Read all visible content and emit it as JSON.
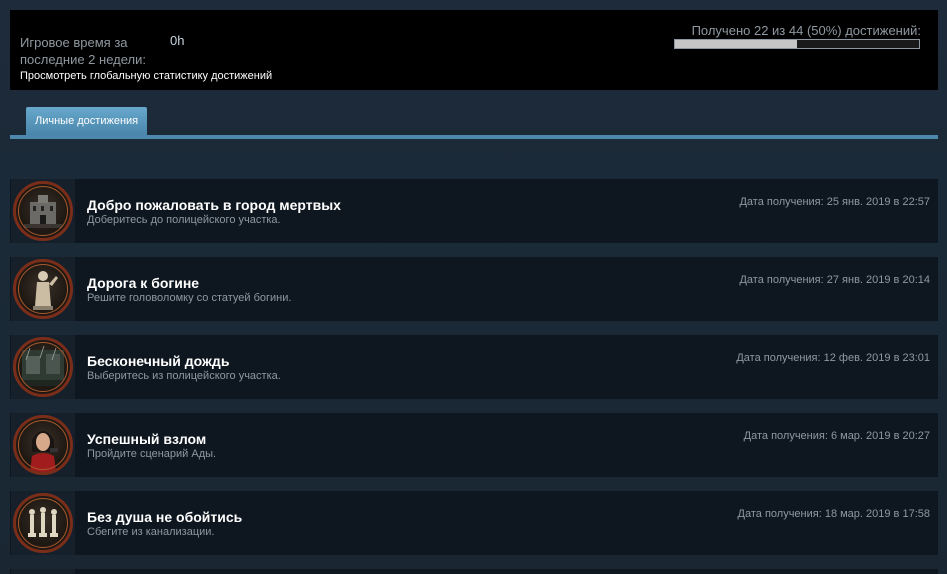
{
  "stats": {
    "playtime_label": "Игровое время за последние 2 недели:",
    "playtime_value": "0h",
    "global_link": "Просмотреть глобальную статистику достижений",
    "progress_text": "Получено 22 из 44 (50%) достижений:",
    "progress_fraction": 0.5
  },
  "tabs": [
    {
      "label": "Личные достижения",
      "active": true
    }
  ],
  "achievements": [
    {
      "title": "Добро пожаловать в город мертвых",
      "description": "Доберитесь до полицейского участка.",
      "date": "Дата получения: 25 янв. 2019 в 22:57",
      "icon": "police-station-icon"
    },
    {
      "title": "Дорога к богине",
      "description": "Решите головоломку со статуей богини.",
      "date": "Дата получения: 27 янв. 2019 в 20:14",
      "icon": "goddess-statue-icon"
    },
    {
      "title": "Бесконечный дождь",
      "description": "Выберитесь из полицейского участка.",
      "date": "Дата получения: 12 фев. 2019 в 23:01",
      "icon": "rainy-courtyard-icon"
    },
    {
      "title": "Успешный взлом",
      "description": "Пройдите сценарий Ады.",
      "date": "Дата получения: 6 мар. 2019 в 20:27",
      "icon": "ada-portrait-icon"
    },
    {
      "title": "Без душа не обойтись",
      "description": "Сбегите из канализации.",
      "date": "Дата получения: 18 мар. 2019 в 17:58",
      "icon": "chess-plugs-icon"
    }
  ],
  "colors": {
    "background": "#1b2838",
    "panel": "#000000",
    "row": "#0e1720",
    "tab": "#5a9ac2",
    "medal_rim": "#7a2e1a"
  }
}
